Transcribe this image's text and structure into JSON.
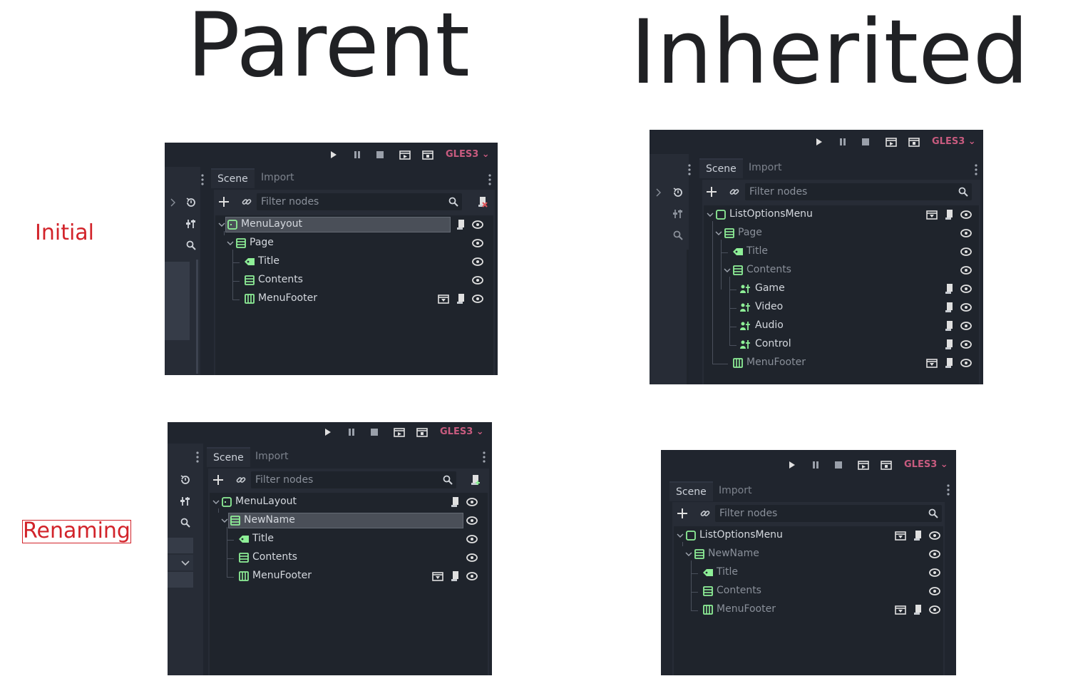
{
  "headings": {
    "parent": "Parent",
    "inherited": "Inherited"
  },
  "row_labels": {
    "initial": "Initial",
    "renaming": "Renaming"
  },
  "common": {
    "renderer": "GLES3",
    "tab_scene": "Scene",
    "tab_import": "Import",
    "filter_placeholder": "Filter nodes"
  },
  "colors": {
    "accent_node": "#8eef97",
    "renderer": "#c85b7f",
    "label_red": "#d2232a"
  },
  "panels": {
    "parent_initial": {
      "nodes": [
        "MenuLayout",
        "Page",
        "Title",
        "Contents",
        "MenuFooter"
      ]
    },
    "inherited_initial": {
      "nodes": [
        "ListOptionsMenu",
        "Page",
        "Title",
        "Contents",
        "Game",
        "Video",
        "Audio",
        "Control",
        "MenuFooter"
      ]
    },
    "parent_renaming": {
      "nodes": [
        "MenuLayout",
        "NewName",
        "Title",
        "Contents",
        "MenuFooter"
      ]
    },
    "inherited_renaming": {
      "nodes": [
        "ListOptionsMenu",
        "NewName",
        "Title",
        "Contents",
        "MenuFooter"
      ]
    }
  }
}
